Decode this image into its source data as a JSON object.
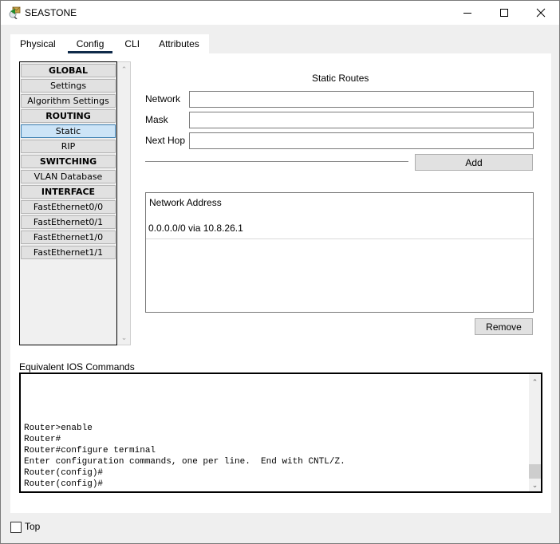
{
  "window": {
    "title": "SEASTONE",
    "controls": {
      "minimize": "minimize-icon",
      "maximize": "maximize-icon",
      "close": "close-icon"
    }
  },
  "tabs": [
    {
      "label": "Physical",
      "active": false
    },
    {
      "label": "Config",
      "active": true
    },
    {
      "label": "CLI",
      "active": false
    },
    {
      "label": "Attributes",
      "active": false
    }
  ],
  "sidebar": {
    "items": [
      {
        "label": "GLOBAL",
        "type": "header"
      },
      {
        "label": "Settings",
        "type": "item"
      },
      {
        "label": "Algorithm Settings",
        "type": "item"
      },
      {
        "label": "ROUTING",
        "type": "header"
      },
      {
        "label": "Static",
        "type": "item",
        "selected": true
      },
      {
        "label": "RIP",
        "type": "item"
      },
      {
        "label": "SWITCHING",
        "type": "header"
      },
      {
        "label": "VLAN Database",
        "type": "item"
      },
      {
        "label": "INTERFACE",
        "type": "header"
      },
      {
        "label": "FastEthernet0/0",
        "type": "item"
      },
      {
        "label": "FastEthernet0/1",
        "type": "item"
      },
      {
        "label": "FastEthernet1/0",
        "type": "item"
      },
      {
        "label": "FastEthernet1/1",
        "type": "item"
      }
    ]
  },
  "static_routes": {
    "title": "Static Routes",
    "fields": {
      "network": {
        "label": "Network",
        "value": ""
      },
      "mask": {
        "label": "Mask",
        "value": ""
      },
      "next_hop": {
        "label": "Next Hop",
        "value": ""
      }
    },
    "add_label": "Add",
    "list_header": "Network Address",
    "routes": [
      "0.0.0.0/0 via 10.8.26.1"
    ],
    "remove_label": "Remove"
  },
  "ios": {
    "label": "Equivalent IOS Commands",
    "text": "Router>enable\nRouter#\nRouter#configure terminal\nEnter configuration commands, one per line.  End with CNTL/Z.\nRouter(config)#\nRouter(config)#"
  },
  "footer": {
    "top_label": "Top",
    "top_checked": false
  }
}
